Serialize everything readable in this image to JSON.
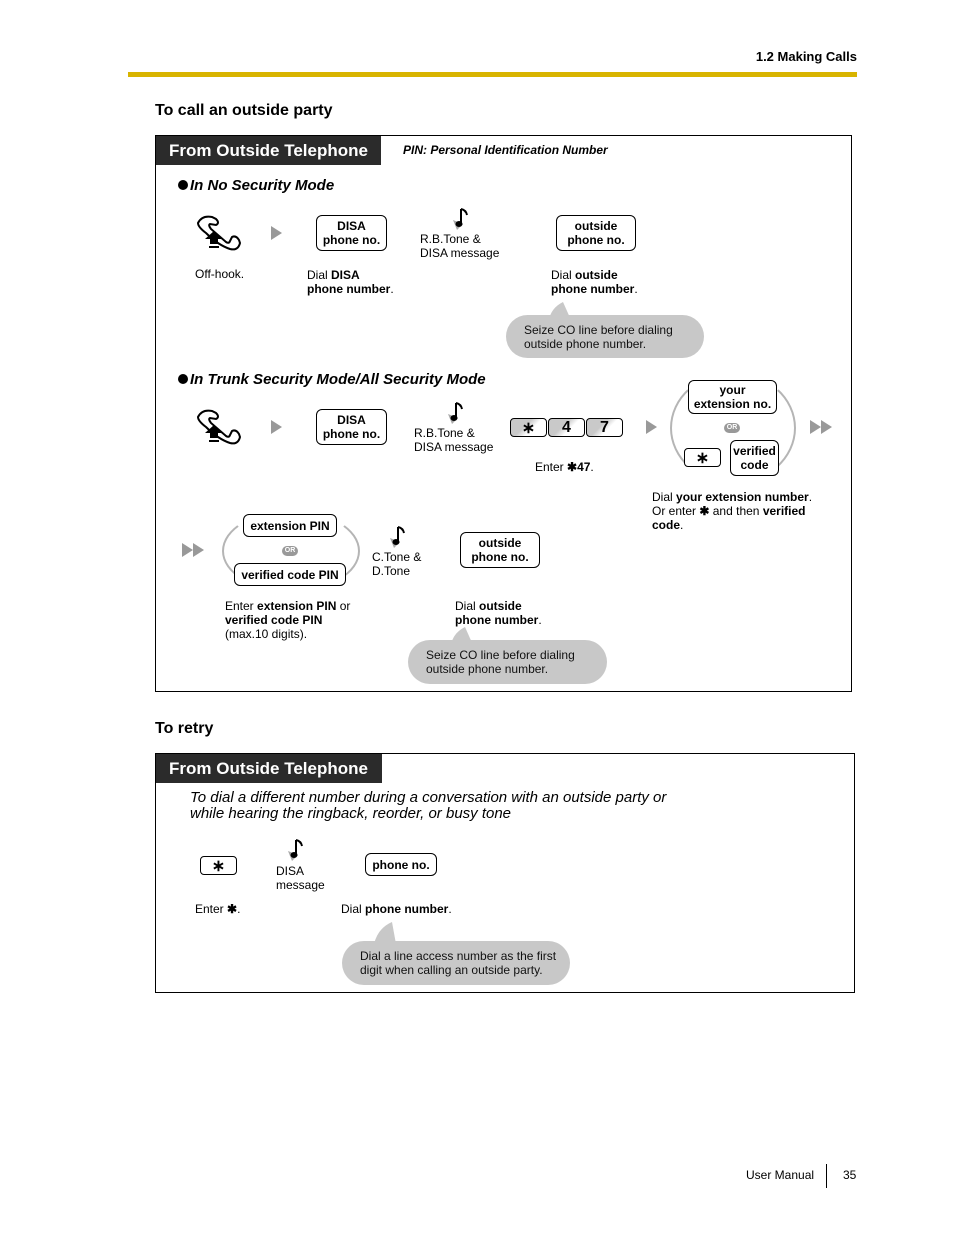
{
  "header": {
    "section": "1.2 Making Calls"
  },
  "call_outside": {
    "title": "To call an outside party",
    "tab": "From Outside Telephone",
    "pin_note": "PIN: Personal Identification Number",
    "no_security": {
      "mode_label": "In No Security Mode",
      "steps": [
        {
          "icon": "off-hook-handset-icon",
          "label": "Off-hook."
        },
        {
          "key": "DISA\nphone no.",
          "label_plain": "Dial ",
          "label_bold1": "DISA",
          "label_bold2": "phone number",
          "label_end": "."
        },
        {
          "icon": "tone-icon",
          "tone": "R.B.Tone &\nDISA message"
        },
        {
          "key": "outside\nphone no.",
          "label_plain": "Dial ",
          "label_bold1": "outside",
          "label_bold2": "phone number",
          "label_end": "."
        }
      ],
      "bubble": "Seize CO line before dialing\noutside phone number."
    },
    "trunk_security": {
      "mode_label": "In Trunk Security Mode/All Security Mode",
      "offhook_label": "Off-hook.",
      "disa_key": "DISA\nphone no.",
      "disa_label_plain": "Dial ",
      "disa_label_bold1": "DISA",
      "disa_label_bold2": "phone number",
      "tone": "R.B.Tone &\nDISA message",
      "feature_keys": [
        "∗",
        "4",
        "7"
      ],
      "enter_label_plain": "Enter ",
      "enter_label_bold": "✱47",
      "ext_key": "your\nextension no.",
      "or_label": "OR",
      "star_key": "∗",
      "verified_key": "verified\ncode",
      "ext_desc": {
        "p1": "Dial ",
        "b1": "your extension number",
        "p2": ".",
        "p3": "Or enter ",
        "star": "✱",
        "p4": " and then ",
        "b2": "verified",
        "b3": "code",
        "p5": "."
      },
      "pin_ext_key": "extension PIN",
      "pin_verified_key": "verified code PIN",
      "pin_desc": {
        "p1": "Enter ",
        "b1": "extension PIN",
        "p2": " or",
        "b2": "verified code PIN",
        "p3": "(max.10 digits)."
      },
      "tone2": "C.Tone &\nD.Tone",
      "outside_key": "outside\nphone no.",
      "outside_label_plain": "Dial ",
      "outside_label_bold1": "outside",
      "outside_label_bold2": "phone number",
      "bubble": "Seize CO line before dialing\noutside phone number."
    }
  },
  "retry": {
    "title": "To retry",
    "tab": "From Outside Telephone",
    "intro": "To dial a different number during a conversation with an outside party or\nwhile hearing the ringback, reorder, or busy tone",
    "star_key": "∗",
    "tone": "DISA\nmessage",
    "phone_key": "phone no.",
    "enter_label_plain": "Enter ",
    "enter_label_star": "✱",
    "dial_label_plain": "Dial ",
    "dial_label_bold": "phone number",
    "bubble": "Dial a line access number as the first\ndigit when calling an outside party."
  },
  "footer": {
    "doc": "User Manual",
    "page": "35"
  },
  "colors": {
    "rule": "#d8b400",
    "tab_bg": "#2b2b2b",
    "bubble": "#c8c8c8",
    "arrow": "#999999"
  }
}
